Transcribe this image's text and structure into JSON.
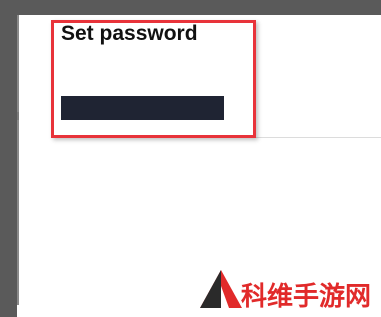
{
  "panel": {
    "title": "Set password",
    "password_value": ""
  },
  "watermark": {
    "text": "科维手游网"
  },
  "colors": {
    "frame": "#5a5a5a",
    "highlight_border": "#e8333a",
    "field_fill": "#1f2433",
    "watermark_red": "#e12a2a"
  }
}
